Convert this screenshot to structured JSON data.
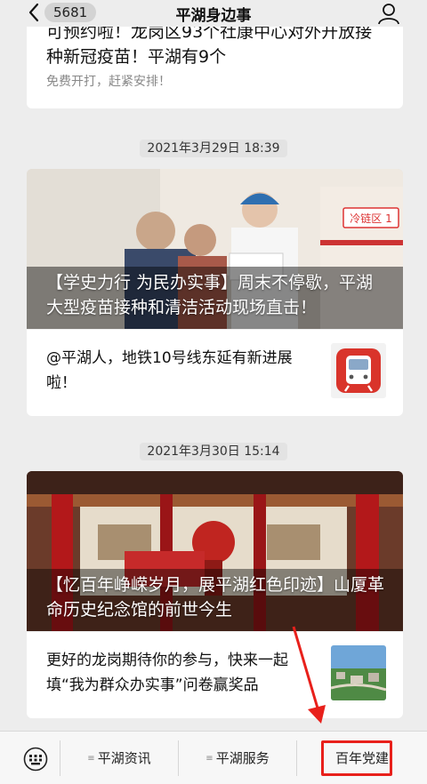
{
  "topbar": {
    "badge": "5681",
    "title": "平湖身边事"
  },
  "feed": {
    "partial_card": {
      "title": "可预约啦！龙岗区93个社康中心对外开放接种新冠疫苗！平湖有9个",
      "subtitle": "免费开打，赶紧安排！"
    },
    "groups": [
      {
        "time": "2021年3月29日 18:39",
        "cover_title": "【学史力行 为民办实事】周末不停歇，平湖大型疫苗接种和清洁活动现场直击！",
        "cover_sign": "冷链区 1",
        "sub_title": "@平湖人，地铁10号线东延有新进展啦！",
        "thumb_icon": "metro-train-icon"
      },
      {
        "time": "2021年3月30日 15:14",
        "cover_title": "【忆百年峥嵘岁月，展平湖红色印迹】山厦革命历史纪念馆的前世今生",
        "sub_title": "更好的龙岗期待你的参与，快来一起填“我为群众办实事”问卷赢奖品",
        "thumb_icon": "aerial-city-photo"
      }
    ]
  },
  "bottom_menu": {
    "items": [
      "平湖资讯",
      "平湖服务",
      "百年党建"
    ],
    "highlight_color": "#e8201b"
  }
}
